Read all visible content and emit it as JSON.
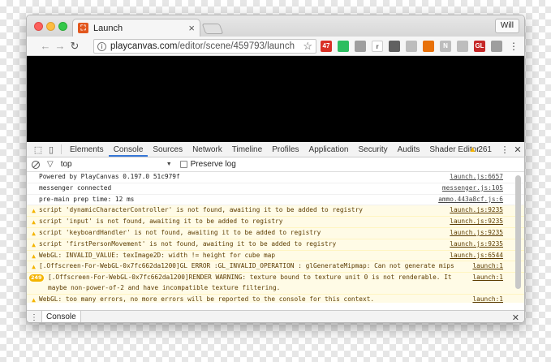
{
  "browser": {
    "tab_title": "Launch",
    "tab_close": "×",
    "user_button": "Will",
    "url_host": "playcanvas.com",
    "url_path": "/editor/scene/459793/launch",
    "back_icon": "←",
    "forward_icon": "→",
    "reload_icon": "↻",
    "star_icon": "☆",
    "menu_icon": "⋮",
    "extensions": [
      {
        "name": "gmail-ext-icon",
        "label": "47",
        "color": "#d93025"
      },
      {
        "name": "evernote-ext-icon",
        "label": "",
        "color": "#2dbe60"
      },
      {
        "name": "extension-icon",
        "label": "",
        "color": "#9e9e9e"
      },
      {
        "name": "readability-ext-icon",
        "label": "r",
        "color": "#ffffff"
      },
      {
        "name": "pocket-ext-icon",
        "label": "",
        "color": "#616161"
      },
      {
        "name": "ghostery-ext-icon",
        "label": "",
        "color": "#bdbdbd"
      },
      {
        "name": "speed-ext-icon",
        "label": "",
        "color": "#e8710a"
      },
      {
        "name": "nimbus-ext-icon",
        "label": "N",
        "color": "#bdbdbd"
      },
      {
        "name": "keep-ext-icon",
        "label": "",
        "color": "#bdbdbd"
      },
      {
        "name": "webgl-ext-icon",
        "label": "GL",
        "color": "#c62828"
      },
      {
        "name": "hangouts-ext-icon",
        "label": "",
        "color": "#9e9e9e"
      }
    ]
  },
  "devtools": {
    "tabs": [
      "Elements",
      "Console",
      "Sources",
      "Network",
      "Timeline",
      "Profiles",
      "Application",
      "Security",
      "Audits",
      "Shader Editor"
    ],
    "active_tab": "Console",
    "warning_count": "261",
    "context": "top",
    "preserve_log": "Preserve log",
    "drawer_tab": "Console",
    "messages": [
      {
        "type": "log",
        "text": "Powered by PlayCanvas 0.197.0 51c979f",
        "source": "launch.js:6657"
      },
      {
        "type": "log",
        "text": "messenger connected",
        "source": "messenger.js:105"
      },
      {
        "type": "log",
        "text": "pre-main prep time: 12 ms",
        "source": "ammo.443a8cf.js:6"
      },
      {
        "type": "warn",
        "text": "script 'dynamicCharacterController' is not found, awaiting it to be added to registry",
        "source": "launch.js:9235"
      },
      {
        "type": "warn",
        "text": "script 'input' is not found, awaiting it to be added to registry",
        "source": "launch.js:9235"
      },
      {
        "type": "warn",
        "text": "script 'keyboardHandler' is not found, awaiting it to be added to registry",
        "source": "launch.js:9235"
      },
      {
        "type": "warn",
        "text": "script 'firstPersonMovement' is not found, awaiting it to be added to registry",
        "source": "launch.js:9235"
      },
      {
        "type": "warn",
        "text": "WebGL: INVALID_VALUE: texImage2D: width != height for cube map",
        "source": "launch.js:6544"
      },
      {
        "type": "warn",
        "text": "[.Offscreen-For-WebGL-0x7fc662da1200]GL ERROR :GL_INVALID_OPERATION : glGenerateMipmap: Can not generate mips",
        "source": "launch:1"
      },
      {
        "type": "warn",
        "badge": "249",
        "text": "[.Offscreen-For-WebGL-0x7fc662da1200]RENDER WARNING: texture bound to texture unit 0 is not renderable. It maybe non-power-of-2 and have incompatible texture filtering.",
        "source": "launch:1"
      },
      {
        "type": "warn",
        "text": "WebGL: too many errors, no more errors will be reported to the console for this context.",
        "source": "launch:1"
      }
    ]
  }
}
